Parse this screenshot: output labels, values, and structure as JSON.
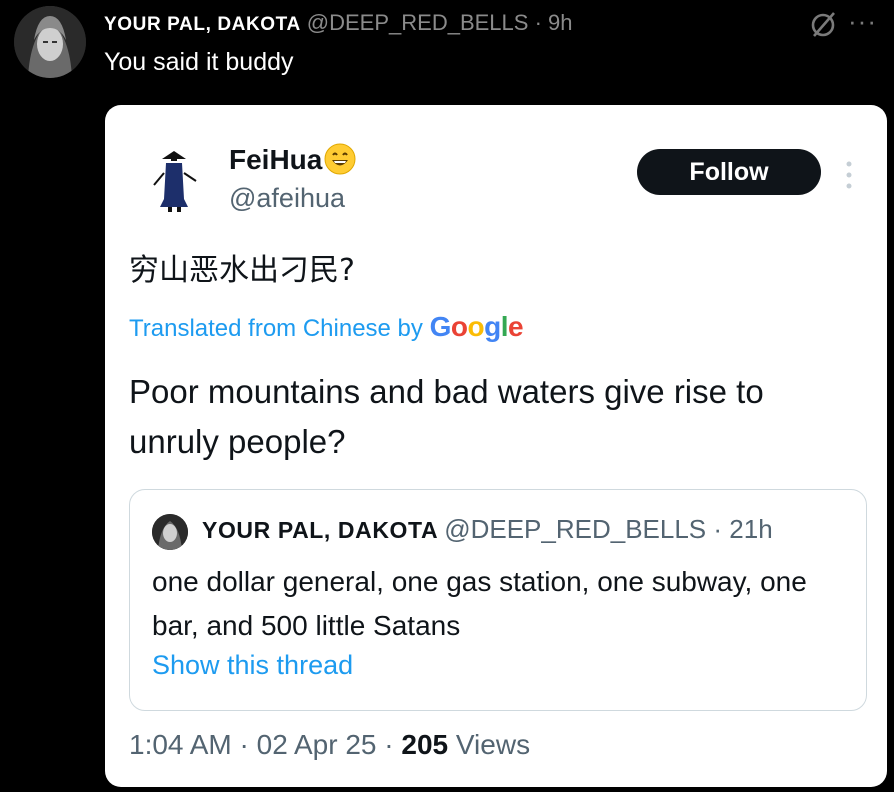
{
  "reply": {
    "author_name": "YOUR PAL, DAKOTA",
    "author_handle": "@DEEP_RED_BELLS",
    "separator": "·",
    "time": "9h",
    "text": "You said it buddy",
    "more_icon": "more-horizontal-icon",
    "status_icon": "slash-circle-icon"
  },
  "card": {
    "author_name": "FeiHua",
    "author_handle": "@afeihua",
    "follow_label": "Follow",
    "original_text": "穷山恶水出刁民?",
    "translated_label": "Translated from Chinese by",
    "translator": "Google",
    "translation": "Poor mountains and bad waters give rise to unruly people?",
    "quote": {
      "author_name": "YOUR PAL, DAKOTA",
      "author_handle": "@DEEP_RED_BELLS",
      "separator": "·",
      "time": "21h",
      "text": "one dollar general, one gas station, one subway, one bar, and 500 little Satans",
      "show_thread": "Show this thread"
    },
    "timestamp": "1:04 AM",
    "date": "02 Apr 25",
    "views_count": "205",
    "views_label": "Views",
    "dot": "·"
  },
  "colors": {
    "background": "#000000",
    "card": "#ffffff",
    "link": "#1d9bf0",
    "muted": "#536471"
  }
}
